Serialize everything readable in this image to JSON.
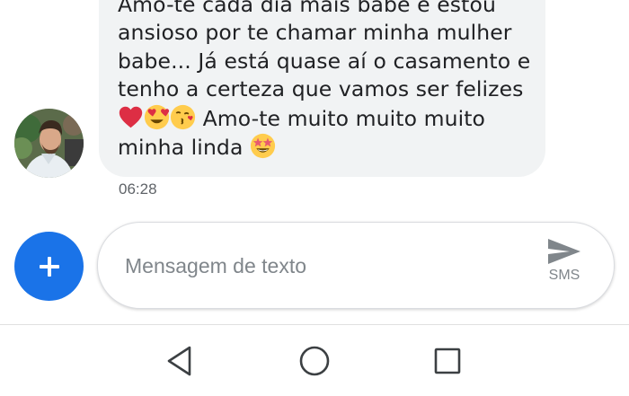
{
  "conversation": {
    "message": {
      "lines": [
        "Amo-te cada dia mais babe e estou",
        "ansioso por te chamar minha mulher",
        "babe... Já está quase aí o casamento e",
        "tenho a certeza que vamos ser felizes",
        " Amo-te muito muito muito",
        "minha linda "
      ],
      "emojis_line5": [
        "red-heart",
        "heart-eyes",
        "face-blowing-kiss"
      ],
      "emoji_line6": "star-struck",
      "timestamp": "06:28"
    }
  },
  "composer": {
    "placeholder": "Mensagem de texto",
    "send_label": "SMS"
  },
  "colors": {
    "accent": "#1a73e8",
    "bubble": "#f1f3f4",
    "icon_gray": "#80868b"
  }
}
